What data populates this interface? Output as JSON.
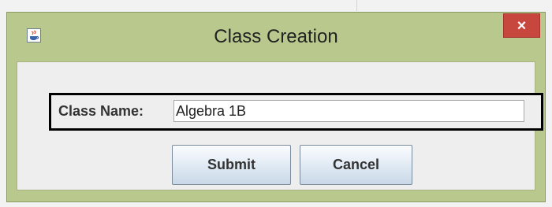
{
  "window": {
    "title": "Class Creation",
    "close_symbol": "×"
  },
  "icons": {
    "app": "java-cup-icon",
    "close": "close-icon"
  },
  "form": {
    "class_name_label": "Class Name:",
    "class_name_value": "Algebra 1B"
  },
  "buttons": {
    "submit_label": "Submit",
    "cancel_label": "Cancel"
  },
  "colors": {
    "frame": "#b9c98e",
    "close_button": "#c7463d",
    "content_bg": "#eeeeee"
  }
}
